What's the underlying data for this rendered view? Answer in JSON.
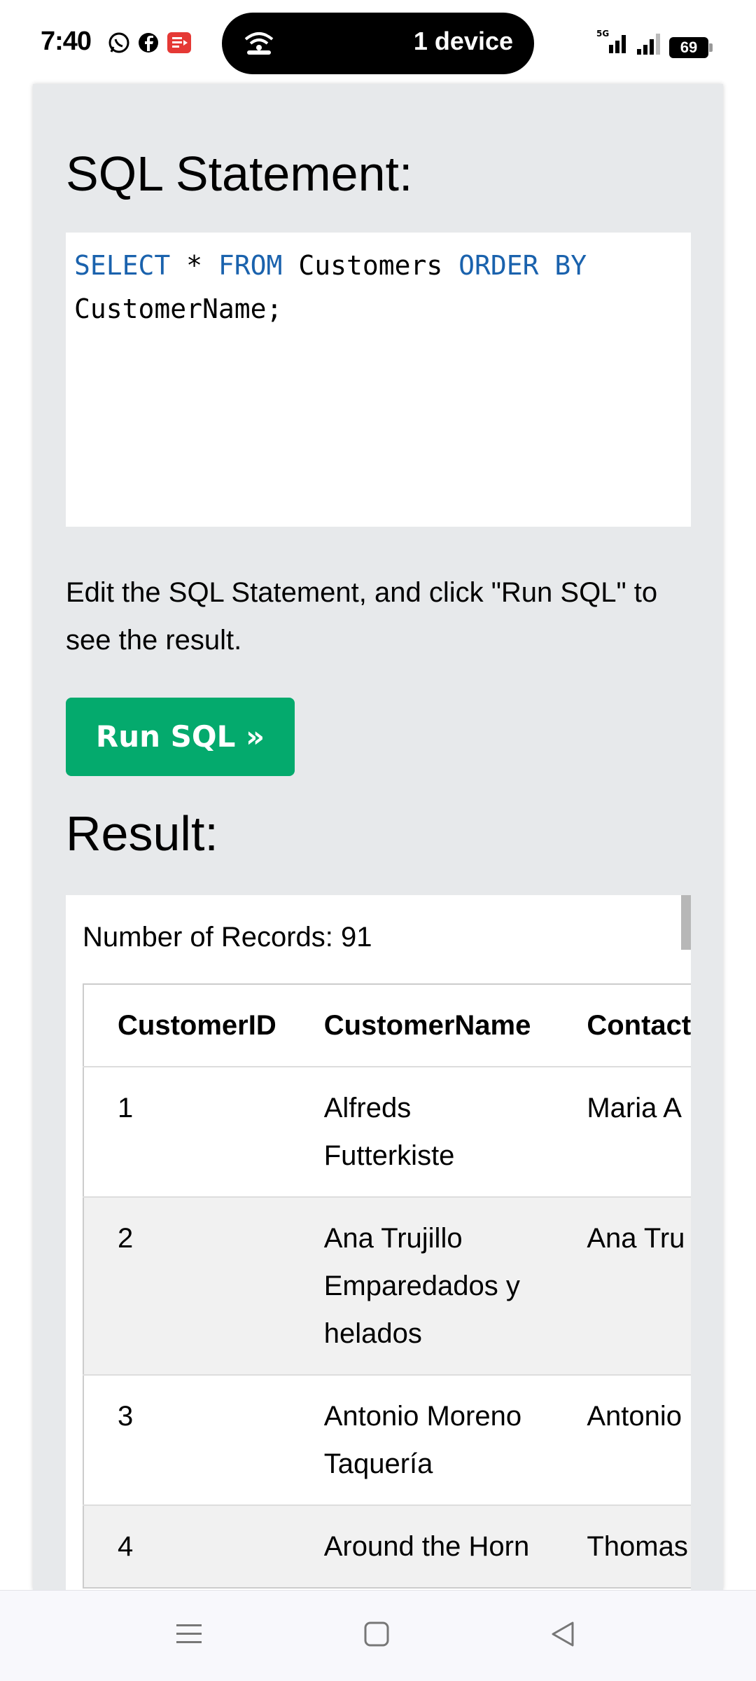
{
  "status_bar": {
    "time": "7:40",
    "app_icons": [
      "whatsapp-icon",
      "facebook-icon",
      "red-app-icon"
    ],
    "island_text": "1 device",
    "network": "5G",
    "battery": "69"
  },
  "sql_section": {
    "title": "SQL Statement:",
    "code": {
      "kw_select": "SELECT",
      "star": " * ",
      "kw_from": "FROM",
      "table": " Customers ",
      "kw_order": "ORDER BY",
      "column": "CustomerName;"
    },
    "hint": "Edit the SQL Statement, and click \"Run SQL\" to see the result.",
    "run_button": "Run SQL »"
  },
  "result_section": {
    "title": "Result:",
    "record_count": "Number of Records: 91",
    "columns": [
      "CustomerID",
      "CustomerName",
      "Contact"
    ],
    "rows": [
      {
        "id": "1",
        "name": "Alfreds Futterkiste",
        "contact": "Maria A"
      },
      {
        "id": "2",
        "name": "Ana Trujillo Emparedados y helados",
        "contact": "Ana Tru"
      },
      {
        "id": "3",
        "name": "Antonio Moreno Taquería",
        "contact": "Antonio"
      },
      {
        "id": "4",
        "name": "Around the Horn",
        "contact": "Thomas"
      }
    ]
  },
  "colors": {
    "keyword": "#1a62ad",
    "run_button": "#04aa6d",
    "panel_bg": "#e7e9eb"
  }
}
